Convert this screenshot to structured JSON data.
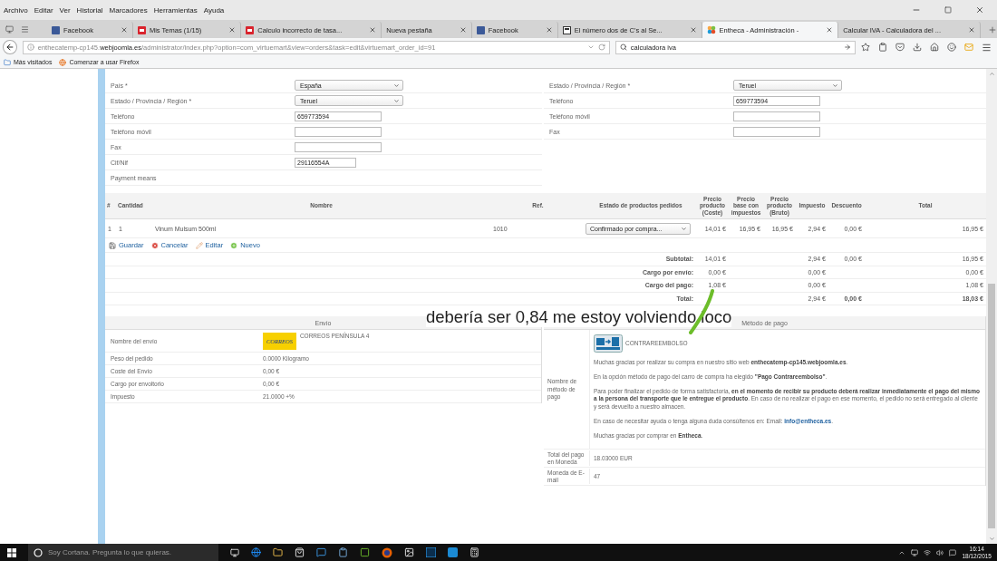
{
  "menu_bar": [
    "Archivo",
    "Editar",
    "Ver",
    "Historial",
    "Marcadores",
    "Herramientas",
    "Ayuda"
  ],
  "tabs": [
    {
      "title": "Facebook",
      "kind": "facebook",
      "selected": false
    },
    {
      "title": "Mis Temas (1/15)",
      "kind": "w",
      "selected": false
    },
    {
      "title": "Calculo incorrecto de tasa...",
      "kind": "w",
      "selected": false
    },
    {
      "title": "Nueva pestaña",
      "kind": "blank",
      "selected": false
    },
    {
      "title": "Facebook",
      "kind": "facebook",
      "selected": false
    },
    {
      "title": "El número dos de C's al Se...",
      "kind": "news",
      "selected": false
    },
    {
      "title": "Entheca - Administración -",
      "kind": "joomla",
      "selected": true
    },
    {
      "title": "Calcular IVA - Calculadora del ...",
      "kind": "blank",
      "selected": false
    }
  ],
  "address_bar": {
    "url": "enthecatemp-cp145.**webjoomla.es**/administrator/index.php?option=com_virtuemart&view=orders&task=edit&virtuemart_order_id=91",
    "search": "calculadora iva"
  },
  "bookmarks": [
    "Más visitados",
    "Comenzar a usar Firefox"
  ],
  "billing": [
    {
      "label": "País *",
      "kind": "select",
      "value": "España"
    },
    {
      "label": "Estado / Provincia / Región *",
      "kind": "select",
      "value": "Teruel"
    },
    {
      "label": "Teléfono",
      "kind": "input",
      "value": "659773594"
    },
    {
      "label": "Teléfono móvil",
      "kind": "input"
    },
    {
      "label": "Fax",
      "kind": "input"
    },
    {
      "label": "Cif/Nif",
      "kind": "short_input",
      "value": "29116554A"
    },
    {
      "label": "Payment means",
      "kind": "none"
    }
  ],
  "shipping_address": [
    {
      "label": "Estado / Provincia / Región *",
      "kind": "select",
      "value": "Teruel"
    },
    {
      "label": "Teléfono",
      "kind": "input",
      "value": "659773594"
    },
    {
      "label": "Teléfono móvil",
      "kind": "input"
    },
    {
      "label": "Fax",
      "kind": "input"
    }
  ],
  "order": {
    "columns": [
      "#",
      "Cantidad",
      "Nombre",
      "Ref.",
      "Estado de productos pedidos",
      "Precio producto (Coste)",
      "Precio base con impuestos",
      "Precio producto (Bruto)",
      "Impuesto",
      "Descuento",
      "Total"
    ],
    "items": [
      {
        "n": "1",
        "qty": "1",
        "name": "Vinum Mulsum 500ml",
        "ref": "1010",
        "status": "Confirmado por compra...",
        "cost": "14,01 €",
        "base": "16,95 €",
        "gross": "16,95 €",
        "tax": "2,94 €",
        "discount": "0,00 €",
        "total": "16,95 €"
      }
    ],
    "actions": [
      {
        "label": "Guardar",
        "kind": "save"
      },
      {
        "label": "Cancelar",
        "kind": "cancel"
      },
      {
        "label": "Editar",
        "kind": "edit"
      },
      {
        "label": "Nuevo",
        "kind": "new"
      }
    ],
    "totals": [
      {
        "label": "Subtotal:",
        "kind": "normal",
        "cost": "14,01 €",
        "tax": "2,94 €",
        "discount": "0,00 €",
        "total": "16,95 €"
      },
      {
        "label": "Cargo por envío:",
        "kind": "normal",
        "cost": "0,00 €",
        "tax": "0,00 €",
        "total": "0,00 €"
      },
      {
        "label": "Cargo del pago:",
        "kind": "normal",
        "cost": "1,08 €",
        "tax": "0,00 €",
        "total": "1,08 €"
      },
      {
        "label": "Total:",
        "kind": "grand",
        "tax": "2,94 €",
        "discount": "0,00 €",
        "total": "18,03 €"
      }
    ]
  },
  "annotation": {
    "text": "debería ser 0,84 me estoy volviendo loco"
  },
  "shipment": {
    "title": "Envío",
    "rows": [
      {
        "label": "Nombre del envío",
        "logo_text": "CORREOS",
        "value": "CORREOS PENÍNSULA 4"
      },
      {
        "label": "Peso del pedido",
        "value": "0.0000 Kilogramo"
      },
      {
        "label": "Coste del Envío",
        "value": "0,00 €"
      },
      {
        "label": "Cargo por envoltorio",
        "value": "0,00 €"
      },
      {
        "label": "Impuesto",
        "value": "21.0000 +%"
      }
    ]
  },
  "payment": {
    "title": "Método de pago",
    "method_label": "Nombre de método de pago",
    "method_name": "CONTRAREEMBOLSO",
    "paragraphs": [
      {
        "text": "Muchas gracias por realizar su compra en nuestro sitio web **enthecatemp-cp145.webjoomla.es**."
      },
      {
        "text": "En la opción método de pago del carro de compra ha elegido **\"Pago Contrareembolso\"**."
      },
      {
        "text": "Para poder finalizar el pedido de forma satisfactoria, **en el momento de recibir su producto deberá realizar inmediatamente el pago del mismo a la persona del transporte que le entregue el producto**. En caso de no realizar el pago en ese momento, el pedido no será entregado al cliente y será devuelto a nuestro almacen."
      },
      {
        "text": "En caso de necesitar ayuda o tenga alguna duda consúltenos en: Email: ",
        "link": "info@entheca.es",
        "after": "."
      },
      {
        "text": "Muchas gracias por comprar en **Entheca**."
      }
    ],
    "rows": [
      {
        "label": "Total del pago en Moneda",
        "value": "18.03000 EUR"
      },
      {
        "label": "Moneda de E-mail",
        "value": "47"
      }
    ]
  },
  "taskbar": {
    "search_placeholder": "Soy Cortana. Pregunta lo que quieras.",
    "time": "16:14",
    "date": "18/12/2015"
  }
}
